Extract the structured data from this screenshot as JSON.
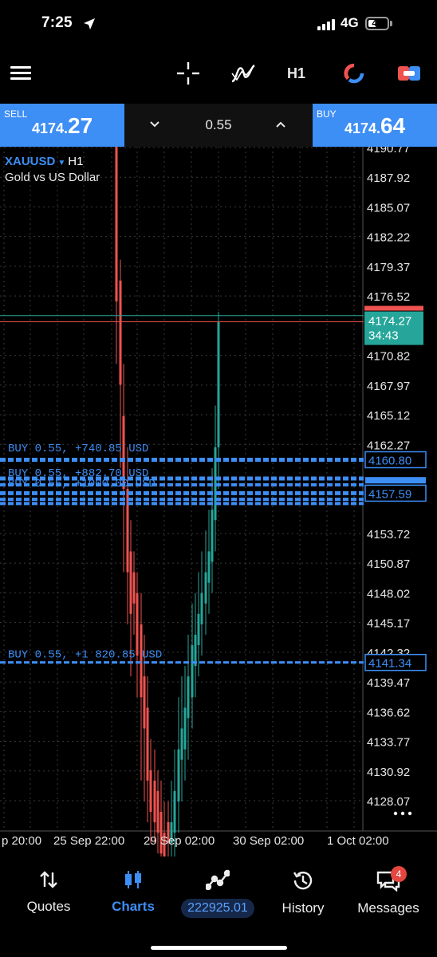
{
  "status": {
    "time": "7:25",
    "network": "4G",
    "battery": "40"
  },
  "toolbar": {
    "timeframe": "H1",
    "icons": [
      "menu-icon",
      "crosshair-icon",
      "indicators-icon",
      "timeframe",
      "color-scheme-icon",
      "one-click-trading-icon"
    ]
  },
  "trade": {
    "sell_label": "SELL",
    "sell_price_small": "4174.",
    "sell_price_big": "27",
    "buy_label": "BUY",
    "buy_price_small": "4174.",
    "buy_price_big": "64",
    "volume": "0.55"
  },
  "chart": {
    "symbol": "XAUUSD",
    "timeframe": "H1",
    "description": "Gold vs US Dollar",
    "current_price": "4174.27",
    "countdown": "34:43",
    "price_ticks": [
      "4190.77",
      "4187.92",
      "4185.07",
      "4182.22",
      "4179.37",
      "4176.52",
      "4170.82",
      "4167.97",
      "4165.12",
      "4162.27",
      "4153.72",
      "4150.87",
      "4148.02",
      "4145.17",
      "4142.32",
      "4139.47",
      "4136.62",
      "4133.77",
      "4130.92",
      "4128.07"
    ],
    "time_ticks": [
      "p 20:00",
      "25 Sep 22:00",
      "29 Sep 02:00",
      "30 Sep 02:00",
      "1 Oct 02:00"
    ],
    "orders": [
      {
        "label": "BUY 0.55,  +740.85 USD",
        "price": "4160.80"
      },
      {
        "label": "BUY 0.55,  +882.70 USD",
        "price": ""
      },
      {
        "label": "BUY 0.55,  +1000.00 USD",
        "price": "4157.59"
      },
      {
        "label": "BUY 0.55,  +1 820.85 USD",
        "price": "4141.34"
      }
    ],
    "colors": {
      "bull": "#26a69a",
      "bear": "#ef5350",
      "order": "#3d8ef5",
      "grid": "#3a3a3a",
      "bid": "#ef5350",
      "ask": "#26a69a"
    }
  },
  "nav": {
    "quotes": "Quotes",
    "charts": "Charts",
    "balance": "222925.01",
    "history": "History",
    "messages": "Messages",
    "messages_badge": "4"
  }
}
